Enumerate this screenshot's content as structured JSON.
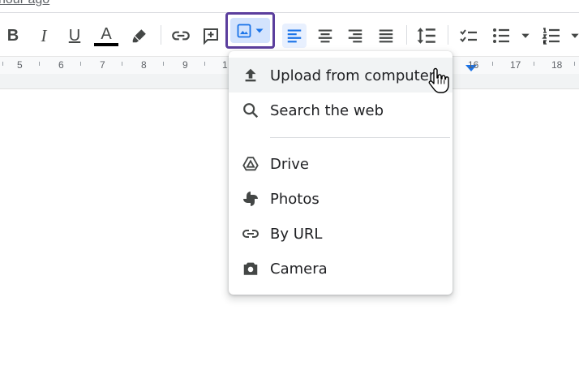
{
  "header": {
    "edited_text": "hour ago"
  },
  "toolbar": {
    "bold": "B",
    "italic": "I",
    "underline": "U",
    "text_color": "A",
    "text_color_value": "#000000",
    "image_button_icon": "image-icon",
    "accent": "#5b3e9d"
  },
  "ruler": {
    "numbers": [
      "5",
      "6",
      "7",
      "8",
      "9",
      "1",
      "16",
      "17",
      "18"
    ]
  },
  "insert_image_menu": {
    "items": [
      {
        "label": "Upload from computer",
        "icon": "upload-icon"
      },
      {
        "label": "Search the web",
        "icon": "search-icon"
      },
      {
        "label": "Drive",
        "icon": "drive-icon"
      },
      {
        "label": "Photos",
        "icon": "photos-icon"
      },
      {
        "label": "By URL",
        "icon": "link-icon"
      },
      {
        "label": "Camera",
        "icon": "camera-icon"
      }
    ]
  }
}
